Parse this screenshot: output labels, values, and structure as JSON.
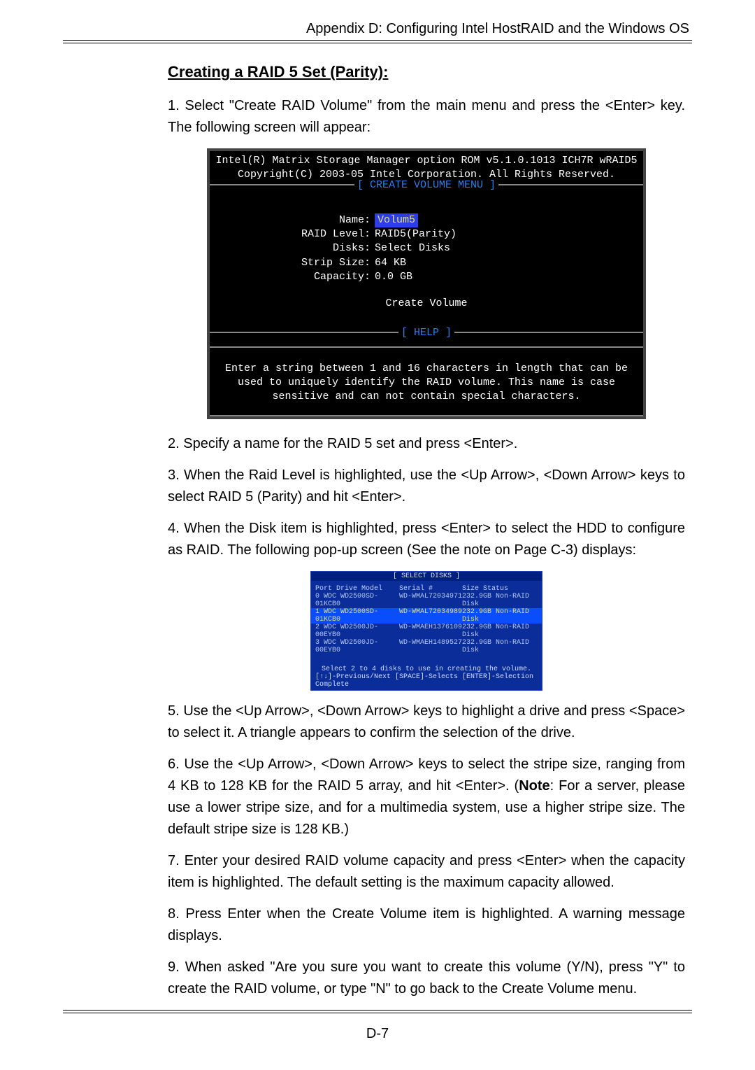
{
  "header": "Appendix D: Configuring Intel HostRAID and the Windows OS",
  "section_title": "Creating a RAID 5 Set (Parity):",
  "intro1": "1. Select \"Create RAID Volume\" from the main menu and press the <Enter> key. The following screen will appear:",
  "bios": {
    "line1": "Intel(R) Matrix Storage Manager option ROM v5.1.0.1013 ICH7R wRAID5",
    "line2": "Copyright(C) 2003-05 Intel Corporation. All Rights Reserved.",
    "create_menu_title": "[ CREATE VOLUME MENU ]",
    "fields": {
      "name_label": "Name:",
      "name_value": "Volum5",
      "raid_label": "RAID Level:",
      "raid_value": "RAID5(Parity)",
      "disks_label": "Disks:",
      "disks_value": "Select Disks",
      "strip_label": "Strip Size:",
      "strip_value": "64  KB",
      "cap_label": "Capacity:",
      "cap_value": "0.0   GB"
    },
    "create_volume": "Create Volume",
    "help_title": "[ HELP ]",
    "help_body": "Enter a string between 1 and 16 characters in length that can be used to uniquely identify the RAID volume. This name is case sensitive and can not contain special characters."
  },
  "step2": "2. Specify a name for the RAID 5 set and press <Enter>.",
  "step3": "3. When the Raid Level is highlighted, use the <Up Arrow>, <Down Arrow> keys to select  RAID 5 (Parity) and hit <Enter>.",
  "step4": "4. When the Disk item is highlighted, press <Enter> to select the HDD to configure as RAID.  The following pop-up screen (See the note on Page C-3) displays:",
  "select_disks": {
    "title": "[ SELECT DISKS ]",
    "header": {
      "c1": "Port Drive Model",
      "c2": "Serial #",
      "c3": "Size Status"
    },
    "rows": [
      {
        "c1": "0 WDC WD2500SD-01KCB0",
        "c2": "WD-WMAL72034971",
        "c3": "232.9GB Non-RAID Disk",
        "hi": false
      },
      {
        "c1": "1 WDC WD2500SD-01KCB0",
        "c2": "WD-WMAL72034989",
        "c3": "232.9GB Non-RAID Disk",
        "hi": true
      },
      {
        "c1": "2 WDC WD2500JD-00EYB0",
        "c2": "WD-WMAEH1376109",
        "c3": "232.9GB Non-RAID Disk",
        "hi": false
      },
      {
        "c1": "3 WDC WD2500JD-00EYB0",
        "c2": "WD-WMAEH1489527",
        "c3": "232.9GB Non-RAID Disk",
        "hi": false
      }
    ],
    "footer1": "Select 2 to 4 disks to use in creating the volume.",
    "footer2": "[↑↓]-Previous/Next  [SPACE]-Selects  [ENTER]-Selection Complete"
  },
  "step5": "5. Use  the <Up Arrow>, <Down Arrow> keys to highlight a drive and press <Space> to select it. A triangle appears to confirm the selection of the drive.",
  "step6_a": "6. Use  the <Up Arrow>, <Down Arrow> keys to select the stripe size, ranging from 4 KB to 128 KB for the RAID 5 array, and hit <Enter>. (",
  "step6_note": "Note",
  "step6_b": ": For a server, please use a lower stripe size, and for a multimedia system, use a higher stripe size. The default stripe size is 128 KB.)",
  "step7": "7. Enter your desired RAID volume capacity and press <Enter> when the capacity item is highlighted. The default setting is the maximum capacity allowed.",
  "step8": "8.  Press Enter when the Create Volume item is highlighted. A warning message displays.",
  "step9": "9. When asked \"Are you sure you want to create this volume (Y/N), press \"Y\" to create the RAID volume, or type \"N\" to go back to the Create Volume menu.",
  "page_number": "D-7"
}
